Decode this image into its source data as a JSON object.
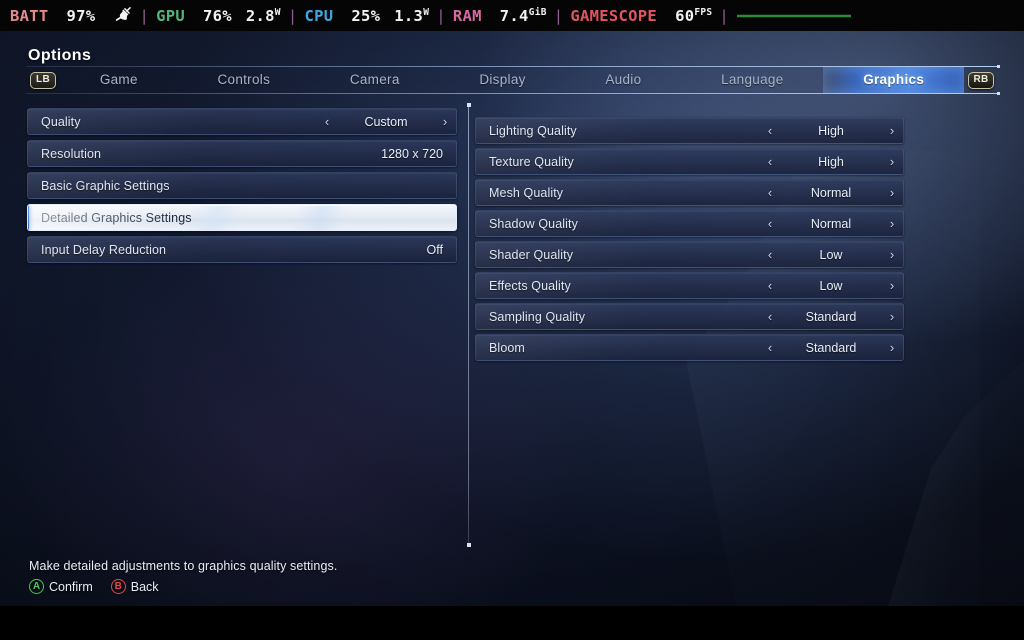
{
  "hud": {
    "battery_label": "BATT",
    "battery_value": "97%",
    "plug_icon": "power-plug-icon",
    "gpu_label": "GPU",
    "gpu_util": "76%",
    "gpu_power": "2.8",
    "gpu_power_unit": "W",
    "cpu_label": "CPU",
    "cpu_util": "25%",
    "cpu_power": "1.3",
    "cpu_power_unit": "W",
    "ram_label": "RAM",
    "ram_value": "7.4",
    "ram_unit": "GiB",
    "gamescope_label": "GAMESCOPE",
    "fps_value": "60",
    "fps_unit": "FPS",
    "separator": "|",
    "colors": {
      "battery": "#e58b8b",
      "gpu": "#55b37a",
      "cpu": "#3fa7e0",
      "ram": "#d46a9e",
      "gamescope": "#e05562",
      "value": "#f2f2f2",
      "separator": "#8e5f8e",
      "frametime_line": "#2f8a36"
    }
  },
  "header": {
    "title": "Options"
  },
  "tabs": {
    "left_bumper": "LB",
    "right_bumper": "RB",
    "items": [
      {
        "label": "Game",
        "active": false
      },
      {
        "label": "Controls",
        "active": false
      },
      {
        "label": "Camera",
        "active": false
      },
      {
        "label": "Display",
        "active": false
      },
      {
        "label": "Audio",
        "active": false
      },
      {
        "label": "Language",
        "active": false
      },
      {
        "label": "Graphics",
        "active": true
      }
    ],
    "active_label": "Graphics",
    "accent_color": "#4e88e6"
  },
  "left_panel": {
    "rows": [
      {
        "name": "Quality",
        "value": "Custom",
        "stepper": true,
        "selected": false
      },
      {
        "name": "Resolution",
        "value": "1280 x 720",
        "stepper": false,
        "selected": false
      },
      {
        "name": "Basic Graphic Settings",
        "value": "",
        "stepper": false,
        "selected": false
      },
      {
        "name": "Detailed Graphics Settings",
        "value": "",
        "stepper": false,
        "selected": true
      },
      {
        "name": "Input Delay Reduction",
        "value": "Off",
        "stepper": false,
        "selected": false
      }
    ]
  },
  "right_panel": {
    "rows": [
      {
        "name": "Lighting Quality",
        "value": "High",
        "stepper": true
      },
      {
        "name": "Texture Quality",
        "value": "High",
        "stepper": true
      },
      {
        "name": "Mesh Quality",
        "value": "Normal",
        "stepper": true
      },
      {
        "name": "Shadow Quality",
        "value": "Normal",
        "stepper": true
      },
      {
        "name": "Shader Quality",
        "value": "Low",
        "stepper": true
      },
      {
        "name": "Effects Quality",
        "value": "Low",
        "stepper": true
      },
      {
        "name": "Sampling Quality",
        "value": "Standard",
        "stepper": true
      },
      {
        "name": "Bloom",
        "value": "Standard",
        "stepper": true
      }
    ]
  },
  "stepper": {
    "left_arrow": "‹",
    "right_arrow": "›"
  },
  "footer": {
    "description": "Make detailed adjustments to graphics quality settings.",
    "prompts": [
      {
        "button": "A",
        "label": "Confirm",
        "color": "#49c94f"
      },
      {
        "button": "B",
        "label": "Back",
        "color": "#e0484d"
      }
    ]
  }
}
